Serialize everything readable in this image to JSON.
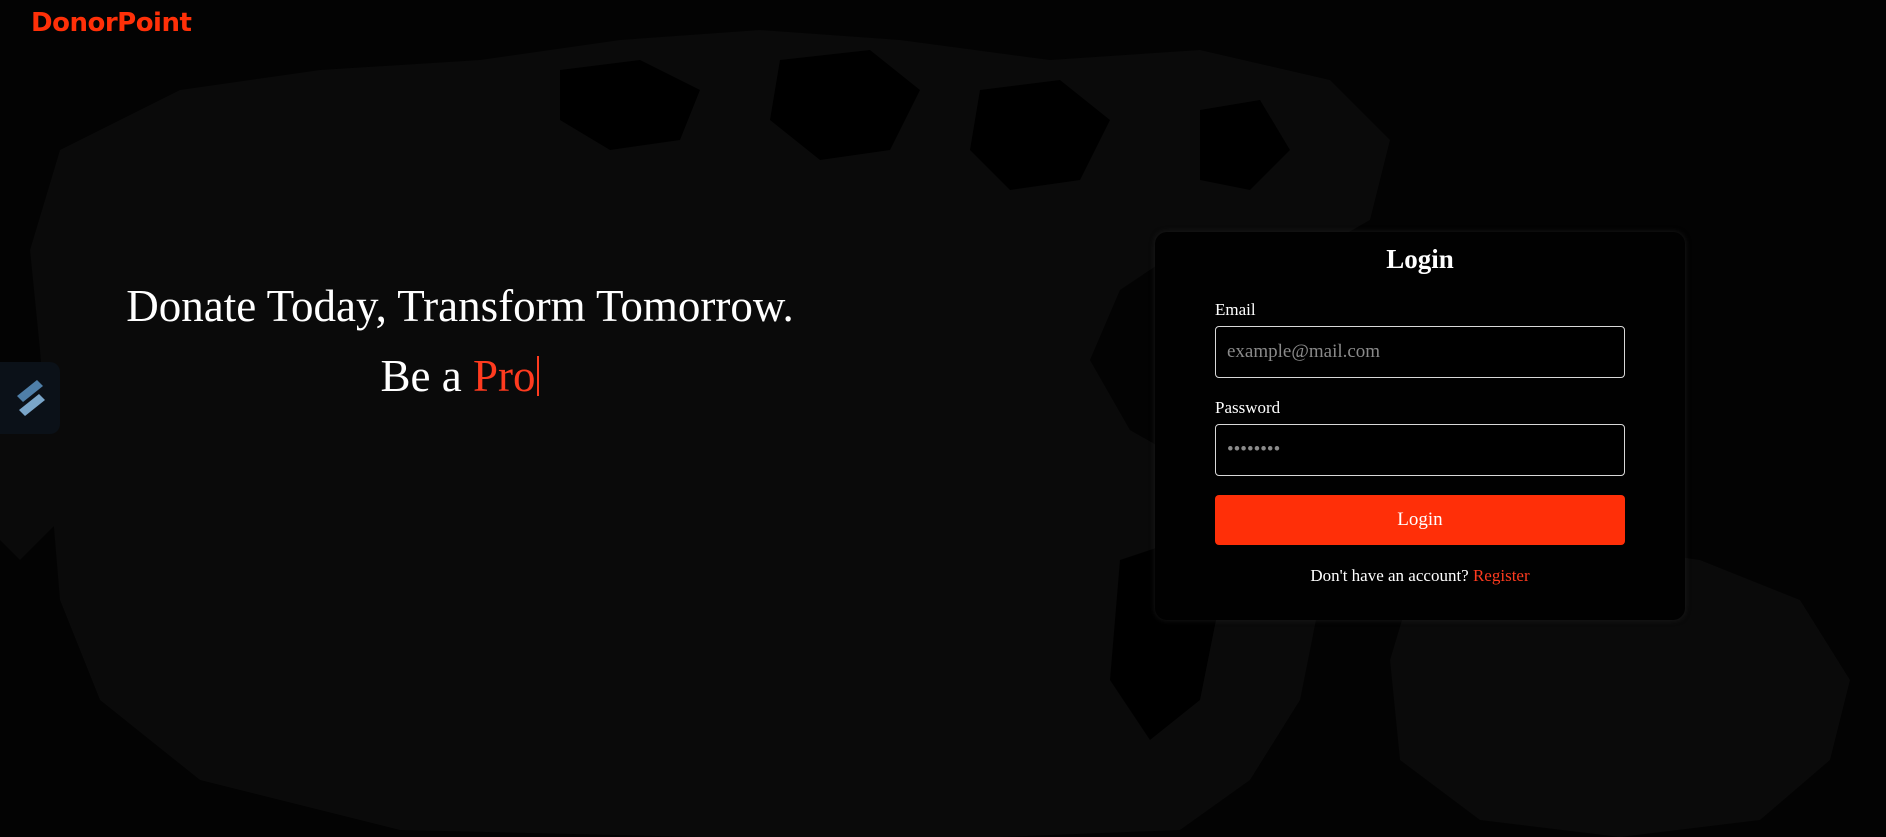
{
  "brand": {
    "name": "DonorPoint",
    "color": "#ff3008"
  },
  "hero": {
    "line1": "Donate Today, Transform Tomorrow.",
    "line2_prefix": "Be a ",
    "line2_typed": "Pro",
    "accent_color": "#ff3b1f"
  },
  "login_form": {
    "title": "Login",
    "email": {
      "label": "Email",
      "placeholder": "example@mail.com",
      "value": ""
    },
    "password": {
      "label": "Password",
      "placeholder": "••••••••",
      "value": ""
    },
    "submit_label": "Login",
    "submit_color": "#ff2f08",
    "register_prompt": "Don't have an account?",
    "register_link": "Register",
    "register_color": "#ff3b1f"
  },
  "side_widget": {
    "icon": "extension-logo-icon"
  }
}
